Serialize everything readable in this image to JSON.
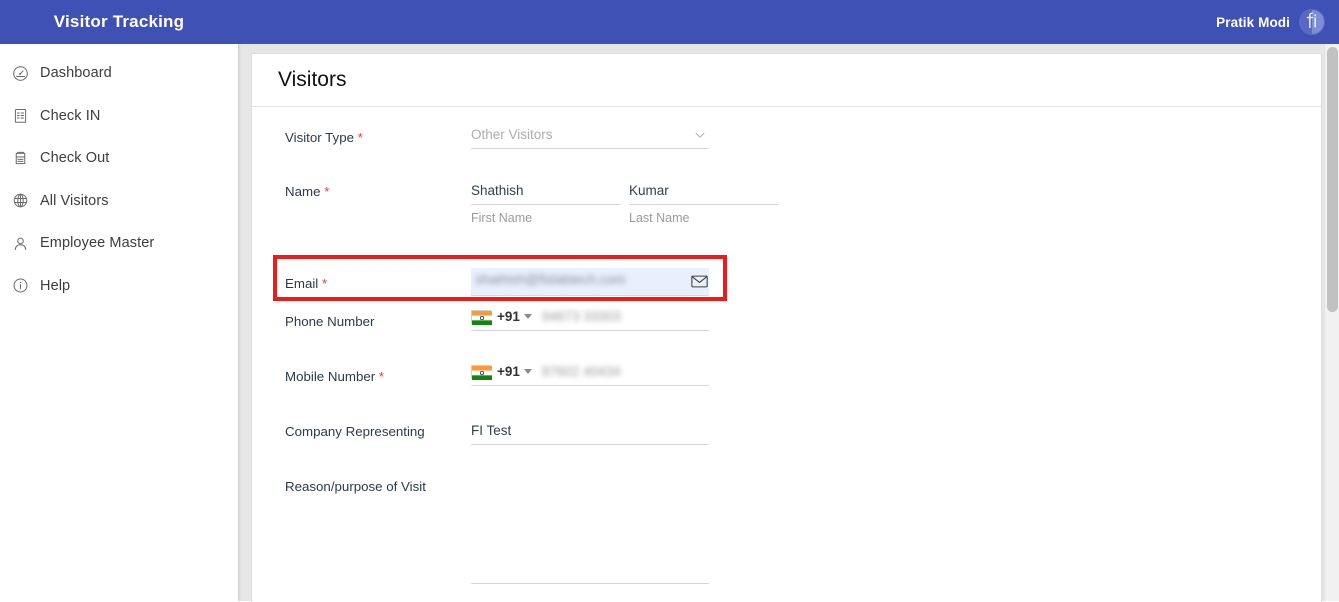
{
  "app": {
    "brand": "Visitor Tracking",
    "accent_color": "#3f51b5",
    "highlight_color": "#ee1b1b",
    "autofill_color": "#e8f0fe"
  },
  "header": {
    "user_name": "Pratik Modi",
    "avatar_icon": "fi-logo-avatar"
  },
  "sidebar": {
    "items": [
      {
        "label": "Dashboard",
        "icon": "dashboard-icon"
      },
      {
        "label": "Check IN",
        "icon": "checkin-icon"
      },
      {
        "label": "Check Out",
        "icon": "checkout-icon"
      },
      {
        "label": "All Visitors",
        "icon": "globe-icon"
      },
      {
        "label": "Employee Master",
        "icon": "user-icon"
      },
      {
        "label": "Help",
        "icon": "info-icon"
      }
    ]
  },
  "card": {
    "title": "Visitors"
  },
  "form": {
    "visitor_type": {
      "label": "Visitor Type",
      "required": "*",
      "value": "Other Visitors",
      "chevron_icon": "chevron-down-icon"
    },
    "name": {
      "label": "Name",
      "required": "*",
      "first_value": "Shathish",
      "first_helper": "First Name",
      "first_placeholder": "First Name",
      "last_value": "Kumar",
      "last_helper": "Last Name",
      "last_placeholder": "Last Name"
    },
    "email": {
      "label": "Email",
      "required": "*",
      "value": "shathish@fislabtech.com",
      "placeholder": "",
      "icon": "envelope-icon",
      "redacted": true
    },
    "phone": {
      "label": "Phone Number",
      "required": "",
      "dial_code": "+91",
      "flag_icon": "india-flag-icon",
      "caret_icon": "caret-down-icon",
      "value": "94673 33303",
      "redacted": true
    },
    "mobile": {
      "label": "Mobile Number",
      "required": "*",
      "dial_code": "+91",
      "flag_icon": "india-flag-icon",
      "caret_icon": "caret-down-icon",
      "value": "87602 40434",
      "redacted": true
    },
    "company": {
      "label": "Company Representing",
      "required": "",
      "value": "FI Test",
      "placeholder": ""
    },
    "reason": {
      "label": "Reason/purpose of Visit",
      "required": "",
      "value": "",
      "placeholder": ""
    }
  },
  "scrollbar": {
    "position": "right"
  }
}
